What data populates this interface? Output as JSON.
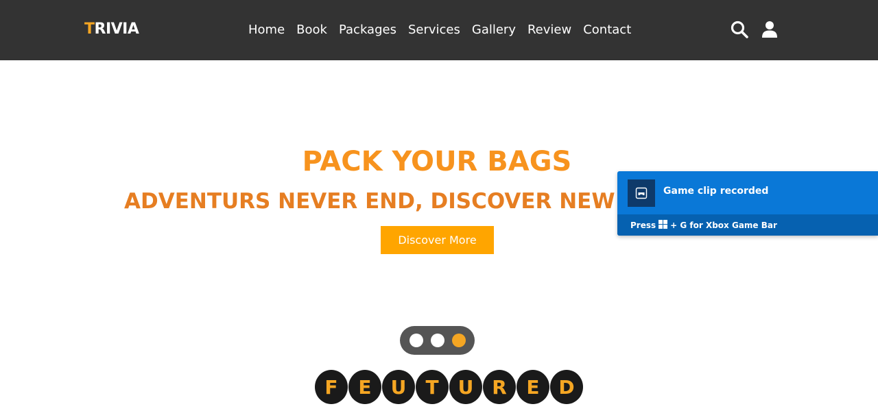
{
  "header": {
    "logo": {
      "first_letter": "T",
      "rest": "RIVIA"
    },
    "nav": [
      "Home",
      "Book",
      "Packages",
      "Services",
      "Gallery",
      "Review",
      "Contact"
    ],
    "icons": [
      "search-icon",
      "user-icon"
    ]
  },
  "hero": {
    "title": "PACK YOUR BAGS",
    "subtitle": "ADVENTURS NEVER END, DISCOVER NEW PATHS",
    "cta_label": "Discover More"
  },
  "slider": {
    "dot_count": 3,
    "active_index": 2
  },
  "featured": {
    "letters": [
      "F",
      "E",
      "U",
      "T",
      "U",
      "R",
      "E",
      "D"
    ]
  },
  "toast": {
    "title": "Game clip recorded",
    "footer_prefix": "Press",
    "footer_suffix": "+ G for Xbox Game Bar",
    "icon": "game-controller-icon"
  },
  "colors": {
    "header_bg": "#333333",
    "accent": "#f5a623",
    "hero_title": "#f7931e",
    "cta_bg": "#ffa500",
    "toast_bg": "#0a78d7",
    "toast_footer_bg": "#0661b0"
  }
}
